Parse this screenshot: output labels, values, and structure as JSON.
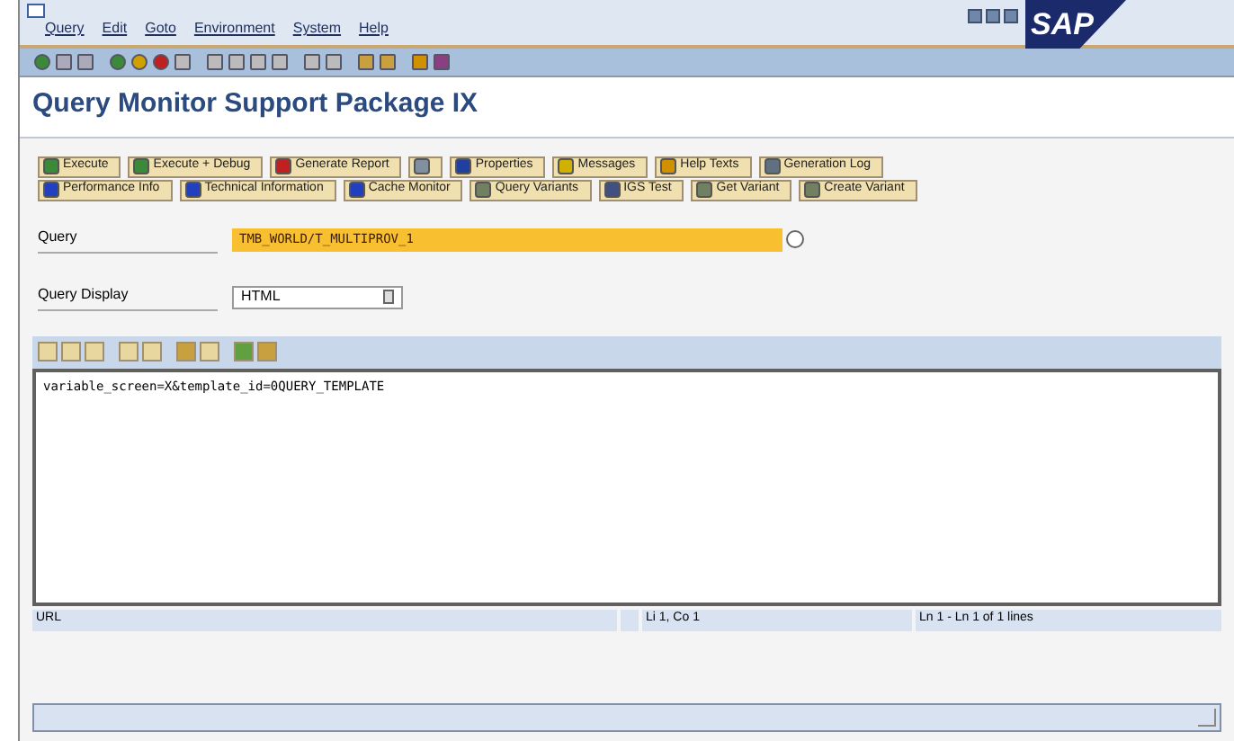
{
  "menu": [
    "Query",
    "Edit",
    "Goto",
    "Environment",
    "System",
    "Help"
  ],
  "logo": "SAP",
  "title": "Query Monitor Support Package IX",
  "button_rows": [
    [
      {
        "kind": "text",
        "label": "Execute"
      },
      {
        "kind": "text",
        "label": "Execute + Debug"
      },
      {
        "kind": "text",
        "label": "Generate Report"
      },
      {
        "kind": "icon"
      },
      {
        "kind": "text",
        "label": "Properties"
      },
      {
        "kind": "text",
        "label": "Messages"
      },
      {
        "kind": "text",
        "label": "Help Texts"
      },
      {
        "kind": "text",
        "label": "Generation Log"
      }
    ],
    [
      {
        "kind": "text",
        "label": "Performance Info"
      },
      {
        "kind": "text",
        "label": "Technical Information"
      },
      {
        "kind": "text",
        "label": "Cache Monitor"
      },
      {
        "kind": "text",
        "label": "Query Variants"
      },
      {
        "kind": "text",
        "label": "IGS Test"
      },
      {
        "kind": "text",
        "label": "Get Variant"
      },
      {
        "kind": "text",
        "label": "Create Variant"
      }
    ]
  ],
  "query": {
    "label": "Query",
    "value": "TMB_WORLD/T_MULTIPROV_1"
  },
  "query_display": {
    "label": "Query Display",
    "value": "HTML"
  },
  "editor": {
    "text": "variable_screen=X&template_id=0QUERY_TEMPLATE"
  },
  "editor_status": {
    "field": "URL",
    "position": "Li 1, Co 1",
    "lines": "Ln 1 - Ln 1 of 1 lines"
  }
}
